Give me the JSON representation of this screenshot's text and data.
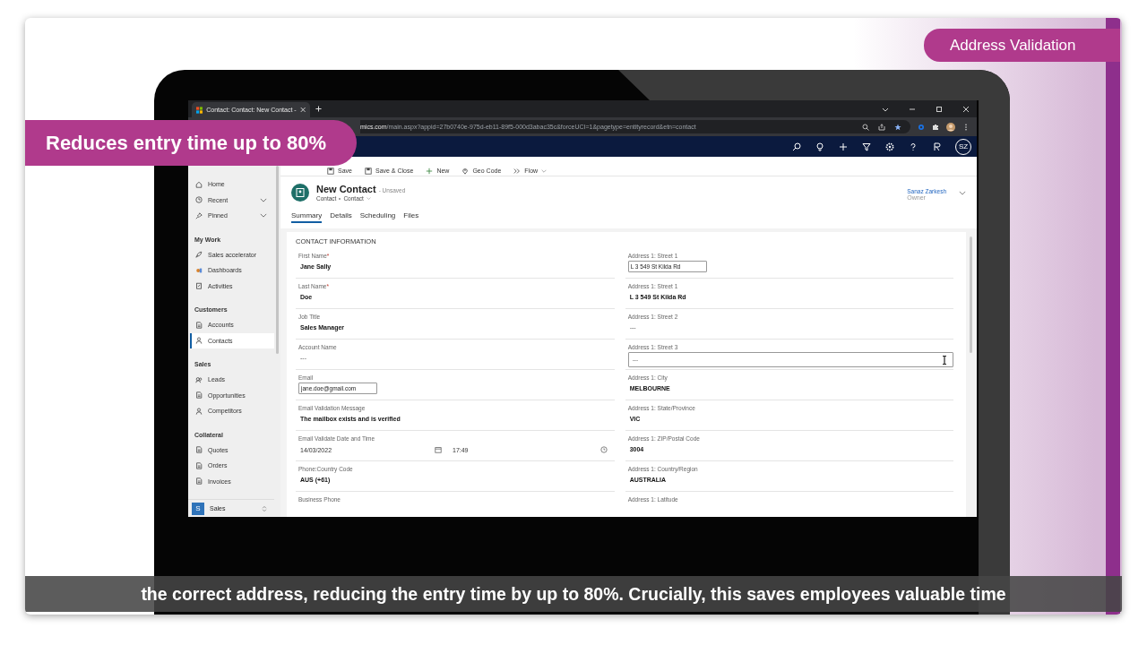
{
  "overlay": {
    "topic_badge": "Address Validation",
    "claim_badge": "Reduces entry time up to 80%",
    "subtitle": "the correct address, reducing the entry time by up to 80%. Crucially, this saves employees valuable time"
  },
  "browser": {
    "tab_title": "Contact: Contact: New Contact -",
    "url_host": "mics.com",
    "url_path": "/main.aspx?appid=27b0740e-975d-eb11-89f5-000d3abac35c&forceUCI=1&pagetype=entityrecord&etn=contact"
  },
  "app_bar": {
    "avatar": "SZ"
  },
  "command_bar": [
    {
      "kind": "save",
      "label": "Save"
    },
    {
      "kind": "save-close",
      "label": "Save & Close"
    },
    {
      "kind": "new",
      "label": "New"
    },
    {
      "kind": "geo",
      "label": "Geo Code"
    },
    {
      "kind": "flow",
      "label": "Flow"
    }
  ],
  "sidebar": {
    "items": [
      {
        "kind": "item",
        "label": "Home",
        "selected": false,
        "expandable": false
      },
      {
        "kind": "item",
        "label": "Recent",
        "selected": false,
        "expandable": true
      },
      {
        "kind": "item",
        "label": "Pinned",
        "selected": false,
        "expandable": true
      },
      {
        "kind": "header",
        "label": "My Work"
      },
      {
        "kind": "item",
        "label": "Sales accelerator",
        "selected": false,
        "expandable": false
      },
      {
        "kind": "item",
        "label": "Dashboards",
        "selected": false,
        "expandable": false
      },
      {
        "kind": "item",
        "label": "Activities",
        "selected": false,
        "expandable": false
      },
      {
        "kind": "header",
        "label": "Customers"
      },
      {
        "kind": "item",
        "label": "Accounts",
        "selected": false,
        "expandable": false
      },
      {
        "kind": "item",
        "label": "Contacts",
        "selected": true,
        "expandable": false
      },
      {
        "kind": "header",
        "label": "Sales"
      },
      {
        "kind": "item",
        "label": "Leads",
        "selected": false,
        "expandable": false
      },
      {
        "kind": "item",
        "label": "Opportunities",
        "selected": false,
        "expandable": false
      },
      {
        "kind": "item",
        "label": "Competitors",
        "selected": false,
        "expandable": false
      },
      {
        "kind": "header",
        "label": "Collateral"
      },
      {
        "kind": "item",
        "label": "Quotes",
        "selected": false,
        "expandable": false
      },
      {
        "kind": "item",
        "label": "Orders",
        "selected": false,
        "expandable": false
      },
      {
        "kind": "item",
        "label": "Invoices",
        "selected": false,
        "expandable": false
      }
    ],
    "area": {
      "initial": "S",
      "label": "Sales"
    }
  },
  "record": {
    "title": "New Contact",
    "status": "- Unsaved",
    "entity": "Contact",
    "form": "Contact",
    "owner": "Sanaz Zarkesh",
    "owner_role": "Owner"
  },
  "tabs": [
    {
      "label": "Summary",
      "selected": true
    },
    {
      "label": "Details",
      "selected": false
    },
    {
      "label": "Scheduling",
      "selected": false
    },
    {
      "label": "Files",
      "selected": false
    }
  ],
  "section_title": "CONTACT INFORMATION",
  "left_fields": [
    {
      "kind": "text",
      "label": "First Name",
      "required": "*",
      "value": "Jane Sally"
    },
    {
      "kind": "text",
      "label": "Last Name",
      "required": "*",
      "value": "Doe"
    },
    {
      "kind": "text",
      "label": "Job Title",
      "value": "Sales Manager"
    },
    {
      "kind": "empty",
      "label": "Account Name",
      "value": "---"
    },
    {
      "kind": "input",
      "label": "Email",
      "value": "jane.doe@gmail.com"
    },
    {
      "kind": "text",
      "label": "Email Validation Message",
      "value": "The mailbox exists and is verified"
    },
    {
      "kind": "datetime",
      "label": "Email Validate Date and Time",
      "value": "14/03/2022",
      "time": "17:49"
    },
    {
      "kind": "text",
      "label": "Phone:Country Code",
      "value": "AUS (+61)"
    },
    {
      "kind": "label",
      "label": "Business Phone"
    }
  ],
  "right_fields": [
    {
      "kind": "input",
      "label": "Address 1: Street 1",
      "value": "L 3  549 St Kilda Rd"
    },
    {
      "kind": "text",
      "label": "Address 1: Street 1",
      "value": "L 3  549 St Kilda Rd"
    },
    {
      "kind": "empty",
      "label": "Address 1: Street 2",
      "value": "---"
    },
    {
      "kind": "wide-input",
      "label": "Address 1: Street 3",
      "value": "---"
    },
    {
      "kind": "text",
      "label": "Address 1: City",
      "value": "MELBOURNE"
    },
    {
      "kind": "text",
      "label": "Address 1: State/Province",
      "value": "VIC"
    },
    {
      "kind": "text",
      "label": "Address 1: ZIP/Postal Code",
      "value": "3004"
    },
    {
      "kind": "text",
      "label": "Address 1: Country/Region",
      "value": "AUSTRALIA"
    },
    {
      "kind": "label",
      "label": "Address 1: Latitude"
    }
  ]
}
